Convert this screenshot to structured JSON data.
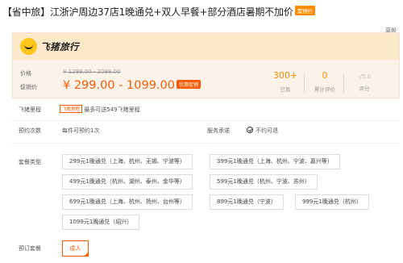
{
  "title": {
    "text": "【省中旅】江浙沪周边37店1晚通兑+双人早餐+部分酒店暑期不加价",
    "tag": "需预约"
  },
  "caogao": "草股",
  "brand": {
    "name": "飞猪旅行"
  },
  "price": {
    "price_label": "价格",
    "original": "¥ 1299.00 - 2099.00",
    "promo_label": "促销价",
    "sale": "¥ 299.00 - 1099.00",
    "sale_badge": "优惠促销"
  },
  "stats": [
    {
      "value": "300+",
      "label": "已售"
    },
    {
      "value": "0",
      "label": "累计评价"
    },
    {
      "value": "-/5.0",
      "label": "评分"
    }
  ],
  "licheng": {
    "label": "飞猪里程",
    "tag": "飞猪里程",
    "text": "最多可送549飞猪里程"
  },
  "booking": {
    "label": "预约次数",
    "text": "每件可预约1次",
    "promise_label": "服务承诺",
    "promise_text": "不约可退"
  },
  "packages": {
    "label": "套餐类型",
    "items": [
      "299元1晚通兑（上海、杭州、无锡、宁波等）",
      "399元1晚通兑（上海、杭州、宁波、嘉兴等）",
      "499元1晚通兑（杭州、湖州、泰州、金华等）",
      "599元1晚通兑（杭州、宁波、苏州）",
      "699元1晚通兑（上海、杭州、扬州、台州等）",
      "899元1晚通兑（宁波）",
      "999元1晚通兑（杭州）",
      "1099元1晚通兑（绍兴）"
    ]
  },
  "order": {
    "label": "预订套餐",
    "option": "成人"
  },
  "colors": {
    "accent": "#ff5a00",
    "orange": "#ff8a00",
    "panel_bg": "#fbf3ea",
    "logo_bar": "#fbe9c9"
  }
}
